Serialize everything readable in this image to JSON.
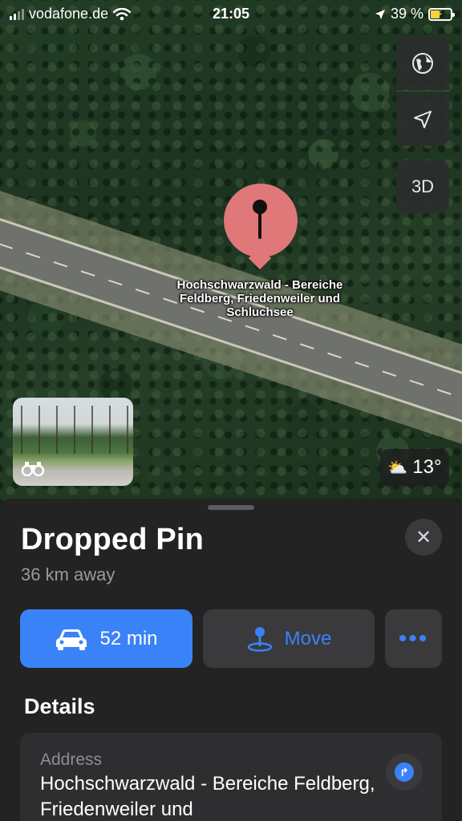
{
  "status_bar": {
    "carrier": "vodafone.de",
    "time": "21:05",
    "battery": "39 %"
  },
  "map": {
    "controls": {
      "globe_icon": "globe-icon",
      "locate_icon": "location-arrow-icon",
      "mode_3d": "3D"
    },
    "pin_label": "Hochschwarzwald - Bereiche Feldberg, Friedenweiler und Schluchsee",
    "lookaround_icon": "binoculars-icon",
    "weather": {
      "icon": "partly-sunny-icon",
      "temperature": "13°"
    }
  },
  "sheet": {
    "title": "Dropped Pin",
    "distance": "36 km away",
    "actions": {
      "drive": {
        "icon": "car-icon",
        "label": "52 min"
      },
      "move": {
        "icon": "pin-move-icon",
        "label": "Move"
      },
      "more": {
        "label": "•••"
      }
    },
    "details_heading": "Details",
    "address": {
      "label": "Address",
      "value": "Hochschwarzwald - Bereiche Feldberg, Friedenweiler und"
    }
  },
  "colors": {
    "accent": "#3a82f7",
    "pin": "#e07779",
    "sheet_bg": "#232323"
  }
}
